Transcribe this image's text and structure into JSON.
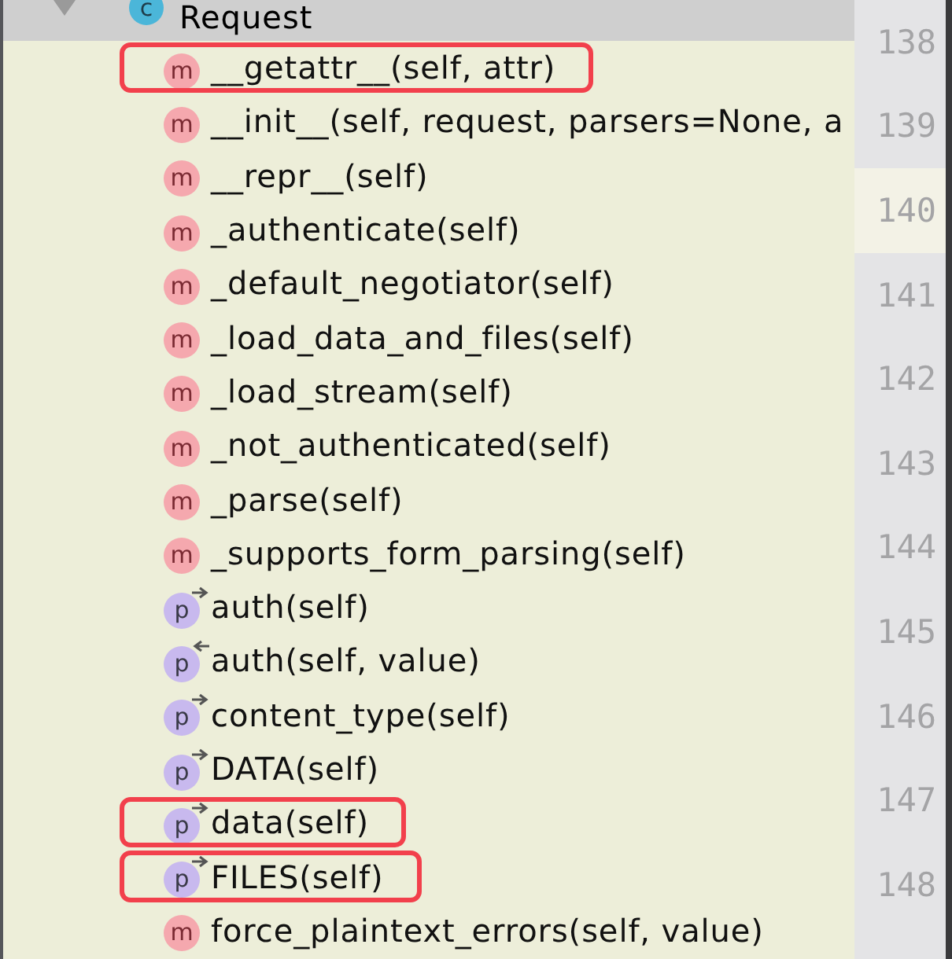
{
  "header": {
    "expanded": true,
    "badge": "c",
    "title": "Request"
  },
  "items": [
    {
      "kind": "method",
      "badge": "m",
      "label": "__getattr__(self, attr)",
      "highlighted": true
    },
    {
      "kind": "method",
      "badge": "m",
      "label": "__init__(self, request, parsers=None, a",
      "highlighted": false
    },
    {
      "kind": "method",
      "badge": "m",
      "label": "__repr__(self)",
      "highlighted": false
    },
    {
      "kind": "method",
      "badge": "m",
      "label": "_authenticate(self)",
      "highlighted": false
    },
    {
      "kind": "method",
      "badge": "m",
      "label": "_default_negotiator(self)",
      "highlighted": false
    },
    {
      "kind": "method",
      "badge": "m",
      "label": "_load_data_and_files(self)",
      "highlighted": false
    },
    {
      "kind": "method",
      "badge": "m",
      "label": "_load_stream(self)",
      "highlighted": false
    },
    {
      "kind": "method",
      "badge": "m",
      "label": "_not_authenticated(self)",
      "highlighted": false
    },
    {
      "kind": "method",
      "badge": "m",
      "label": "_parse(self)",
      "highlighted": false
    },
    {
      "kind": "method",
      "badge": "m",
      "label": "_supports_form_parsing(self)",
      "highlighted": false
    },
    {
      "kind": "getter",
      "badge": "p",
      "label": "auth(self)",
      "highlighted": false
    },
    {
      "kind": "setter",
      "badge": "p",
      "label": "auth(self, value)",
      "highlighted": false
    },
    {
      "kind": "getter",
      "badge": "p",
      "label": "content_type(self)",
      "highlighted": false
    },
    {
      "kind": "getter",
      "badge": "p",
      "label": "DATA(self)",
      "highlighted": false
    },
    {
      "kind": "getter",
      "badge": "p",
      "label": "data(self)",
      "highlighted": true
    },
    {
      "kind": "getter",
      "badge": "p",
      "label": "FILES(self)",
      "highlighted": true
    },
    {
      "kind": "method",
      "badge": "m",
      "label": "force_plaintext_errors(self, value)",
      "highlighted": false
    }
  ],
  "gutter": [
    {
      "number": "138",
      "selected": false
    },
    {
      "number": "139",
      "selected": false
    },
    {
      "number": "140",
      "selected": true
    },
    {
      "number": "141",
      "selected": false
    },
    {
      "number": "142",
      "selected": false
    },
    {
      "number": "143",
      "selected": false
    },
    {
      "number": "144",
      "selected": false
    },
    {
      "number": "145",
      "selected": false
    },
    {
      "number": "146",
      "selected": false
    },
    {
      "number": "147",
      "selected": false
    },
    {
      "number": "148",
      "selected": false
    }
  ]
}
